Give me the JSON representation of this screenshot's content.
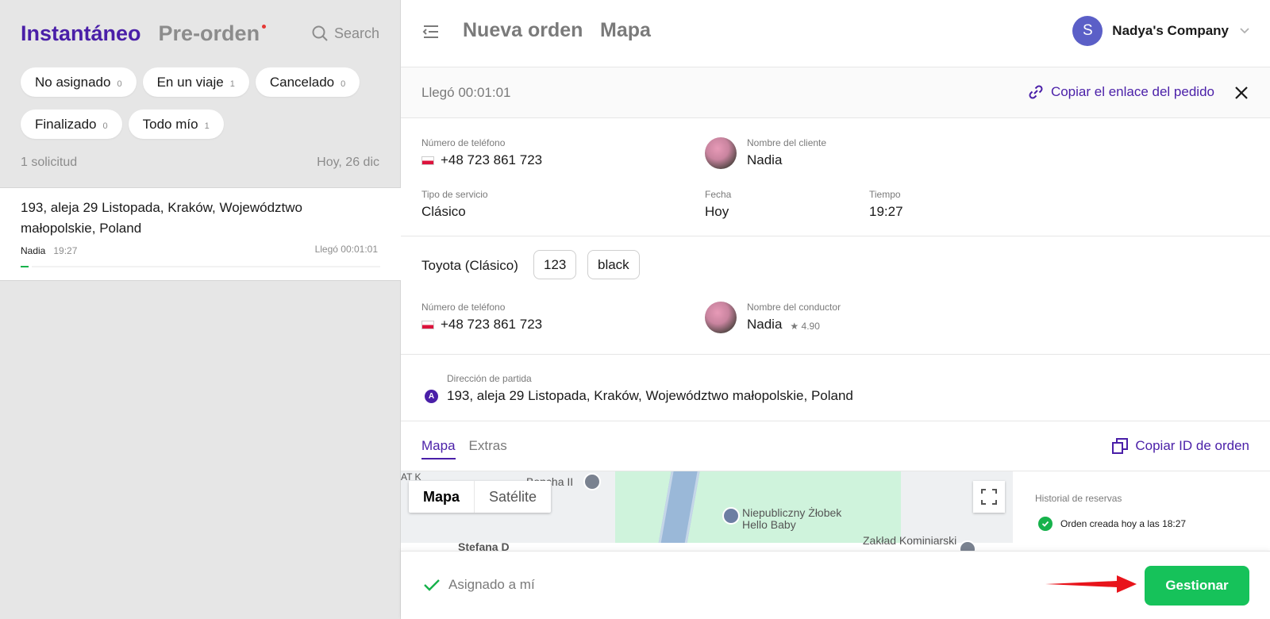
{
  "left": {
    "tabs": {
      "instant": "Instantáneo",
      "preorder": "Pre-orden"
    },
    "search_label": "Search",
    "filters": [
      {
        "label": "No asignado",
        "count": "0"
      },
      {
        "label": "En un viaje",
        "count": "1"
      },
      {
        "label": "Cancelado",
        "count": "0"
      },
      {
        "label": "Finalizado",
        "count": "0"
      },
      {
        "label": "Todo mío",
        "count": "1"
      }
    ],
    "request_count": "1 solicitud",
    "date": "Hoy, 26 dic",
    "order": {
      "address": "193, aleja 29 Listopada, Kraków, Województwo małopolskie, Poland",
      "client": "Nadia",
      "time": "19:27",
      "arrived": "Llegó 00:01:01"
    }
  },
  "topbar": {
    "title": "Nueva orden",
    "subtitle": "Mapa",
    "company_initial": "S",
    "company_name": "Nadya's Company"
  },
  "status": {
    "arrived": "Llegó 00:01:01",
    "copy_link": "Copiar el enlace del pedido"
  },
  "client": {
    "phone_label": "Número de teléfono",
    "phone": "+48 723 861 723",
    "name_label": "Nombre del cliente",
    "name": "Nadia",
    "service_label": "Tipo de servicio",
    "service": "Clásico",
    "date_label": "Fecha",
    "date": "Hoy",
    "time_label": "Tiempo",
    "time": "19:27"
  },
  "vehicle": {
    "car": "Toyota (Clásico)",
    "plate": "123",
    "color": "black"
  },
  "driver": {
    "phone_label": "Número de teléfono",
    "phone": "+48 723 861 723",
    "name_label": "Nombre del conductor",
    "name": "Nadia",
    "rating": "4.90"
  },
  "pickup": {
    "label": "Dirección de partida",
    "marker": "A",
    "address": "193, aleja 29 Listopada, Kraków, Województwo małopolskie, Poland"
  },
  "detail_tabs": {
    "map": "Mapa",
    "extras": "Extras",
    "copy_id": "Copiar ID de orden"
  },
  "map": {
    "btn_map": "Mapa",
    "btn_satellite": "Satélite",
    "labels": {
      "poi1": "Niepubliczny Żłobek Hello Baby",
      "poi2": "Zakład Kominiarski",
      "street1": "Bencha II",
      "street2": "Stefana D",
      "cut": "AT K"
    }
  },
  "history": {
    "title": "Historial de reservas",
    "item": "Orden creada hoy a las 18:27"
  },
  "bottom": {
    "assigned": "Asignado a mí",
    "manage": "Gestionar"
  },
  "colors": {
    "accent": "#4a1fa8",
    "green": "#16c25a",
    "arrow": "#e8141b"
  }
}
